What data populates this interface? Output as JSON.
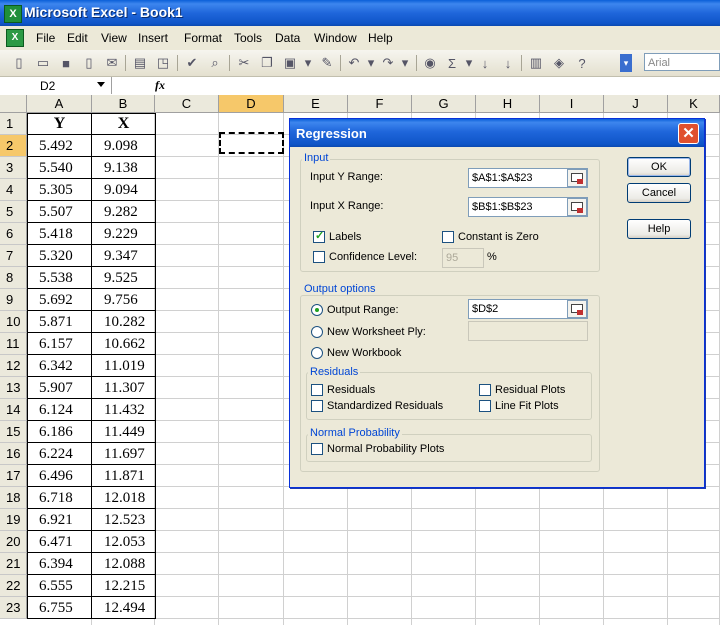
{
  "window": {
    "title": "Microsoft Excel - Book1"
  },
  "menu": [
    "File",
    "Edit",
    "View",
    "Insert",
    "Format",
    "Tools",
    "Data",
    "Window",
    "Help"
  ],
  "toolbar": {
    "font_name": "Arial"
  },
  "formula_bar": {
    "name_box": "D2",
    "fx_label": "fx"
  },
  "columns": [
    "A",
    "B",
    "C",
    "D",
    "E",
    "F",
    "G",
    "H",
    "I",
    "J",
    "K"
  ],
  "rows": [
    "1",
    "2",
    "3",
    "4",
    "5",
    "6",
    "7",
    "8",
    "9",
    "10",
    "11",
    "12",
    "13",
    "14",
    "15",
    "16",
    "17",
    "18",
    "19",
    "20",
    "21",
    "22",
    "23"
  ],
  "headers": {
    "A": "Y",
    "B": "X"
  },
  "data": {
    "Y": [
      "5.492",
      "5.540",
      "5.305",
      "5.507",
      "5.418",
      "5.320",
      "5.538",
      "5.692",
      "5.871",
      "6.157",
      "6.342",
      "5.907",
      "6.124",
      "6.186",
      "6.224",
      "6.496",
      "6.718",
      "6.921",
      "6.471",
      "6.394",
      "6.555",
      "6.755"
    ],
    "X": [
      "9.098",
      "9.138",
      "9.094",
      "9.282",
      "9.229",
      "9.347",
      "9.525",
      "9.756",
      "10.282",
      "10.662",
      "11.019",
      "11.307",
      "11.432",
      "11.449",
      "11.697",
      "11.871",
      "12.018",
      "12.523",
      "12.053",
      "12.088",
      "12.215",
      "12.494"
    ]
  },
  "dialog": {
    "title": "Regression",
    "close": "✕",
    "ok": "OK",
    "cancel": "Cancel",
    "help": "Help",
    "input_group": "Input",
    "input_y_label": "Input Y Range:",
    "input_y_value": "$A$1:$A$23",
    "input_x_label": "Input X Range:",
    "input_x_value": "$B$1:$B$23",
    "labels": "Labels",
    "constant_zero": "Constant is Zero",
    "confidence_level": "Confidence Level:",
    "confidence_value": "95",
    "percent": "%",
    "output_group": "Output options",
    "output_range": "Output Range:",
    "output_range_value": "$D$2",
    "new_ply": "New Worksheet Ply:",
    "new_workbook": "New Workbook",
    "residuals_group": "Residuals",
    "residuals": "Residuals",
    "standardized_residuals": "Standardized Residuals",
    "residual_plots": "Residual Plots",
    "line_fit_plots": "Line Fit Plots",
    "normal_group": "Normal Probability",
    "normal_plots": "Normal Probability Plots"
  }
}
